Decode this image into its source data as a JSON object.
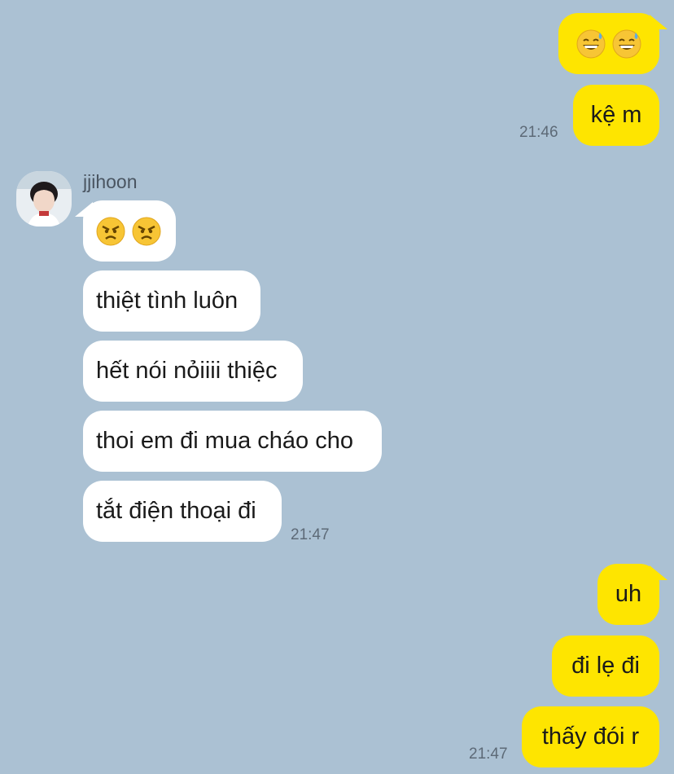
{
  "contact": {
    "name": "jjihoon"
  },
  "messages": {
    "m1": {
      "icons": [
        "grinning-sweat-emoji",
        "grinning-sweat-emoji"
      ]
    },
    "m2": {
      "text": "kệ m",
      "time": "21:46"
    },
    "m3": {
      "icons": [
        "angry-face-emoji",
        "angry-face-emoji"
      ]
    },
    "m4": {
      "text": "thiệt tình luôn"
    },
    "m5": {
      "text": "hết nói nỏiiii thiệc"
    },
    "m6": {
      "text": "thoi em đi mua cháo cho"
    },
    "m7": {
      "text": "tắt điện thoại đi",
      "time": "21:47"
    },
    "m8": {
      "text": "uh"
    },
    "m9": {
      "text": "đi lẹ đi"
    },
    "m10": {
      "text": "thấy đói r",
      "time": "21:47"
    }
  },
  "colors": {
    "background": "#abc1d3",
    "outgoing_bubble": "#fee500",
    "incoming_bubble": "#ffffff"
  }
}
